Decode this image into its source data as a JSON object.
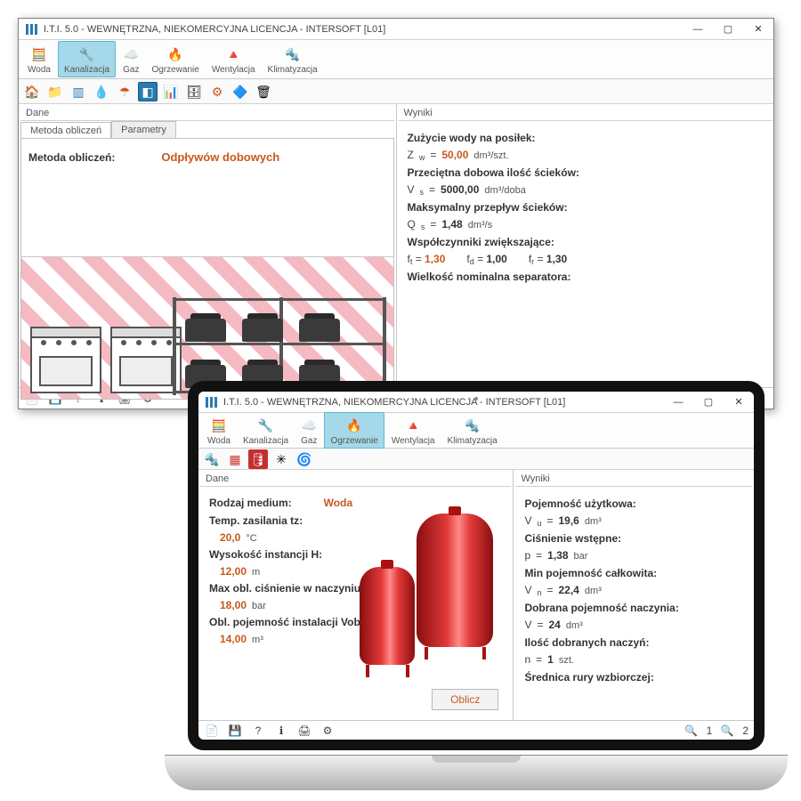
{
  "app": {
    "title": "I.T.I. 5.0 - WEWNĘTRZNA, NIEKOMERCYJNA LICENCJA - INTERSOFT [L01]"
  },
  "topnav": {
    "items": [
      "Woda",
      "Kanalizacja",
      "Gaz",
      "Ogrzewanie",
      "Wentylacja",
      "Klimatyzacja"
    ]
  },
  "window1": {
    "activeTopnav": 1,
    "dane_label": "Dane",
    "wyniki_label": "Wyniki",
    "tabs": [
      "Metoda obliczeń",
      "Parametry"
    ],
    "method_label": "Metoda obliczeń:",
    "method_value": "Odpływów dobowych",
    "results": {
      "h1": "Zużycie wody na posiłek:",
      "zw_sym": "Z",
      "zw_sub": "w",
      "zw_val": "50,00",
      "zw_unit": "dm³/szt.",
      "h2": "Przeciętna dobowa ilość ścieków:",
      "vs_sym": "V",
      "vs_sub": "s",
      "vs_val": "5000,00",
      "vs_unit": "dm³/doba",
      "h3": "Maksymalny przepływ ścieków:",
      "qs_sym": "Q",
      "qs_sub": "s",
      "qs_val": "1,48",
      "qs_unit": "dm³/s",
      "h4": "Współczynniki zwiększające:",
      "ft_sym": "f",
      "ft_sub": "t",
      "ft_val": "1,30",
      "fd_sym": "f",
      "fd_sub": "d",
      "fd_val": "1,00",
      "fr_sym": "f",
      "fr_sub": "r",
      "fr_val": "1,30",
      "h5": "Wielkość nominalna separatora:"
    }
  },
  "window2": {
    "activeTopnav": 3,
    "dane_label": "Dane",
    "wyniki_label": "Wyniki",
    "medium_label": "Rodzaj medium:",
    "medium_value": "Woda",
    "tz_label": "Temp. zasilania tz:",
    "tz_val": "20,0",
    "tz_unit": "°C",
    "h_label": "Wysokość instancji H:",
    "h_val": "12,00",
    "h_unit": "m",
    "pmax_label": "Max obl. ciśnienie w naczyniu Pmax:",
    "pmax_val": "18,00",
    "pmax_unit": "bar",
    "vobl_label": "Obl. pojemność instalacji Vobl:",
    "vobl_val": "14,00",
    "vobl_unit": "m³",
    "calc_btn": "Oblicz",
    "results": {
      "h1": "Pojemność użytkowa:",
      "vu_sym": "V",
      "vu_sub": "u",
      "vu_val": "19,6",
      "vu_unit": "dm³",
      "h2": "Ciśnienie wstępne:",
      "p_sym": "p",
      "p_val": "1,38",
      "p_unit": "bar",
      "h3": "Min pojemność całkowita:",
      "vn_sym": "V",
      "vn_sub": "n",
      "vn_val": "22,4",
      "vn_unit": "dm³",
      "h4": "Dobrana pojemność naczynia:",
      "v_sym": "V",
      "v_val": "24",
      "v_unit": "dm³",
      "h5": "Ilość dobranych naczyń:",
      "n_sym": "n",
      "n_val": "1",
      "n_unit": "szt.",
      "h6": "Średnica rury wzbiorczej:"
    },
    "status_right": {
      "z1": "1",
      "z2": "2"
    }
  }
}
